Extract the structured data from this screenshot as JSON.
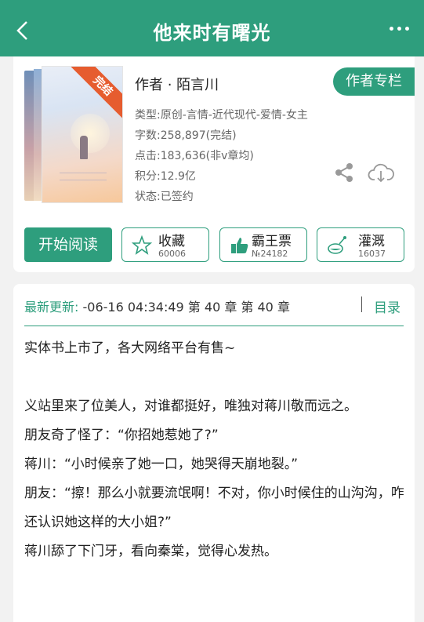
{
  "header": {
    "title": "他来时有曙光",
    "back_icon": "chevron-left-icon",
    "more_icon": "more-dots-icon"
  },
  "book": {
    "cover_badge": "完结",
    "author": "作者 · 陌言川",
    "author_column": "作者专栏",
    "meta": [
      "类型:原创-言情-近代现代-爱情-女主",
      "字数:258,897(完结)",
      "点击:183,636(非v章均)",
      "积分:12.9亿",
      "状态:已签约"
    ]
  },
  "actions": {
    "read": "开始阅读",
    "favorite": {
      "label": "收藏",
      "count": "60006"
    },
    "vote": {
      "label": "霸王票",
      "count": "№24182"
    },
    "water": {
      "label": "灌溉",
      "count": "16037"
    }
  },
  "update": {
    "label": "最新更新:",
    "value": "-06-16 04:34:49   第 40 章 第 40 章",
    "toc": "目录"
  },
  "intro": [
    "实体书上市了，各大网络平台有售~",
    "",
    "义站里来了位美人，对谁都挺好，唯独对蒋川敬而远之。",
    "朋友奇了怪了：“你招她惹她了?”",
    "蒋川：“小时候亲了她一口，她哭得天崩地裂。”",
    "朋友：“擦！那么小就要流氓啊！不对，你小时候住的山沟沟，咋还认识她这样的大小姐?”",
    "蒋川舔了下门牙，看向秦棠，觉得心发热。"
  ],
  "colors": {
    "primary": "#2e9e7d",
    "badge": "#e65c2f"
  }
}
